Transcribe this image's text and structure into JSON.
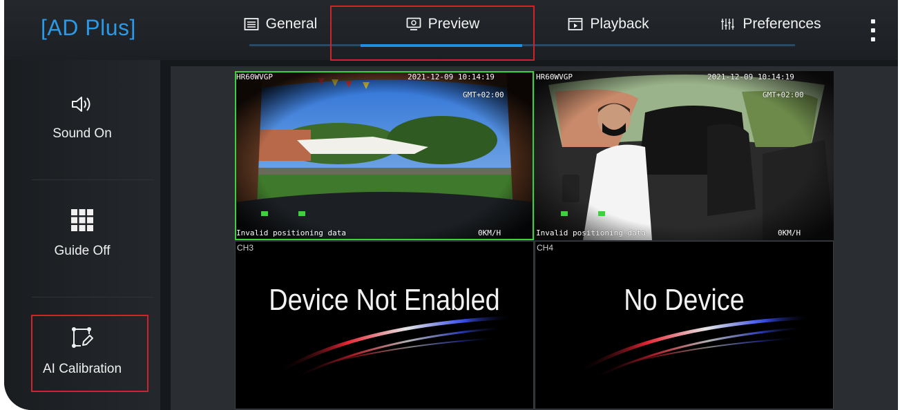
{
  "app": {
    "brand_open": "[",
    "brand": "AD Plus",
    "brand_close": "]"
  },
  "tabs": [
    {
      "label": "General",
      "icon": "list-icon",
      "active": false
    },
    {
      "label": "Preview",
      "icon": "monitor-icon",
      "active": true
    },
    {
      "label": "Playback",
      "icon": "playback-icon",
      "active": false
    },
    {
      "label": "Preferences",
      "icon": "sliders-icon",
      "active": false
    }
  ],
  "sidebar": {
    "items": [
      {
        "label": "Sound On",
        "icon": "speaker-icon"
      },
      {
        "label": "Guide Off",
        "icon": "grid-icon"
      },
      {
        "label": "AI Calibration",
        "icon": "calibration-edit-icon"
      }
    ]
  },
  "channels": [
    {
      "id": "CH1",
      "plate": "HR60WVGP",
      "datetime": "2021-12-09 10:14:19",
      "timezone": "GMT+02:00",
      "gps": "Invalid positioning data",
      "speed": "0KM/H",
      "selected": true
    },
    {
      "id": "CH2",
      "plate": "HR60WVGP",
      "datetime": "2021-12-09 10:14:19",
      "timezone": "GMT+02:00",
      "gps": "Invalid positioning data",
      "speed": "0KM/H",
      "selected": false
    },
    {
      "id": "CH3",
      "message": "Device Not Enabled"
    },
    {
      "id": "CH4",
      "message": "No Device"
    }
  ],
  "colors": {
    "accent": "#1f8fe0",
    "brand": "#2b9ae6",
    "selected_border": "#3cd23c",
    "highlight": "#d0232b"
  }
}
